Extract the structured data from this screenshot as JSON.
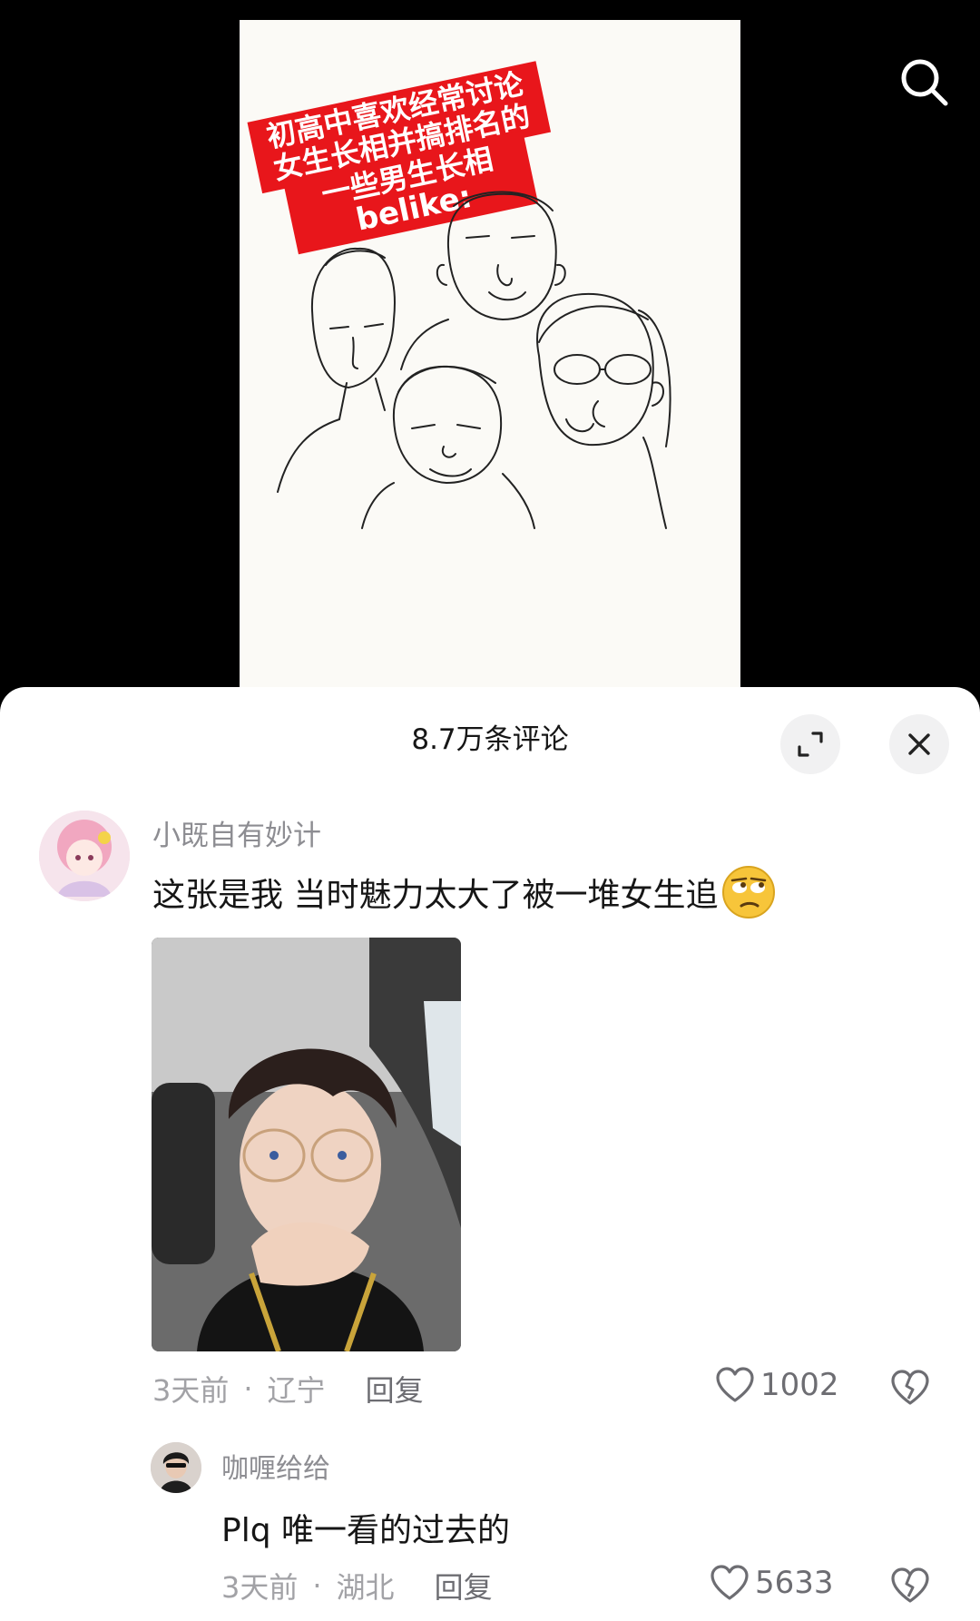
{
  "video": {
    "caption_lines": [
      "初高中喜欢经常讨论",
      "女生长相并搞排名的",
      "一些男生长相",
      "belike:"
    ],
    "accent_color": "#e8161b"
  },
  "search": {
    "icon": "search-icon"
  },
  "comments_sheet": {
    "title": "8.7万条评论",
    "expand_icon": "expand-icon",
    "close_icon": "close-icon"
  },
  "comments": [
    {
      "username": "小既自有妙计",
      "text": "这张是我 当时魅力太大了被一堆女生追",
      "emoji": "rolling-eyes-emoji",
      "time": "3天前",
      "location": "辽宁",
      "reply_label": "回复",
      "likes": "1002"
    },
    {
      "username": "咖喱给给",
      "text": "Plq 唯一看的过去的",
      "time": "3天前",
      "location": "湖北",
      "reply_label": "回复",
      "likes": "5633"
    }
  ],
  "separator": "·"
}
